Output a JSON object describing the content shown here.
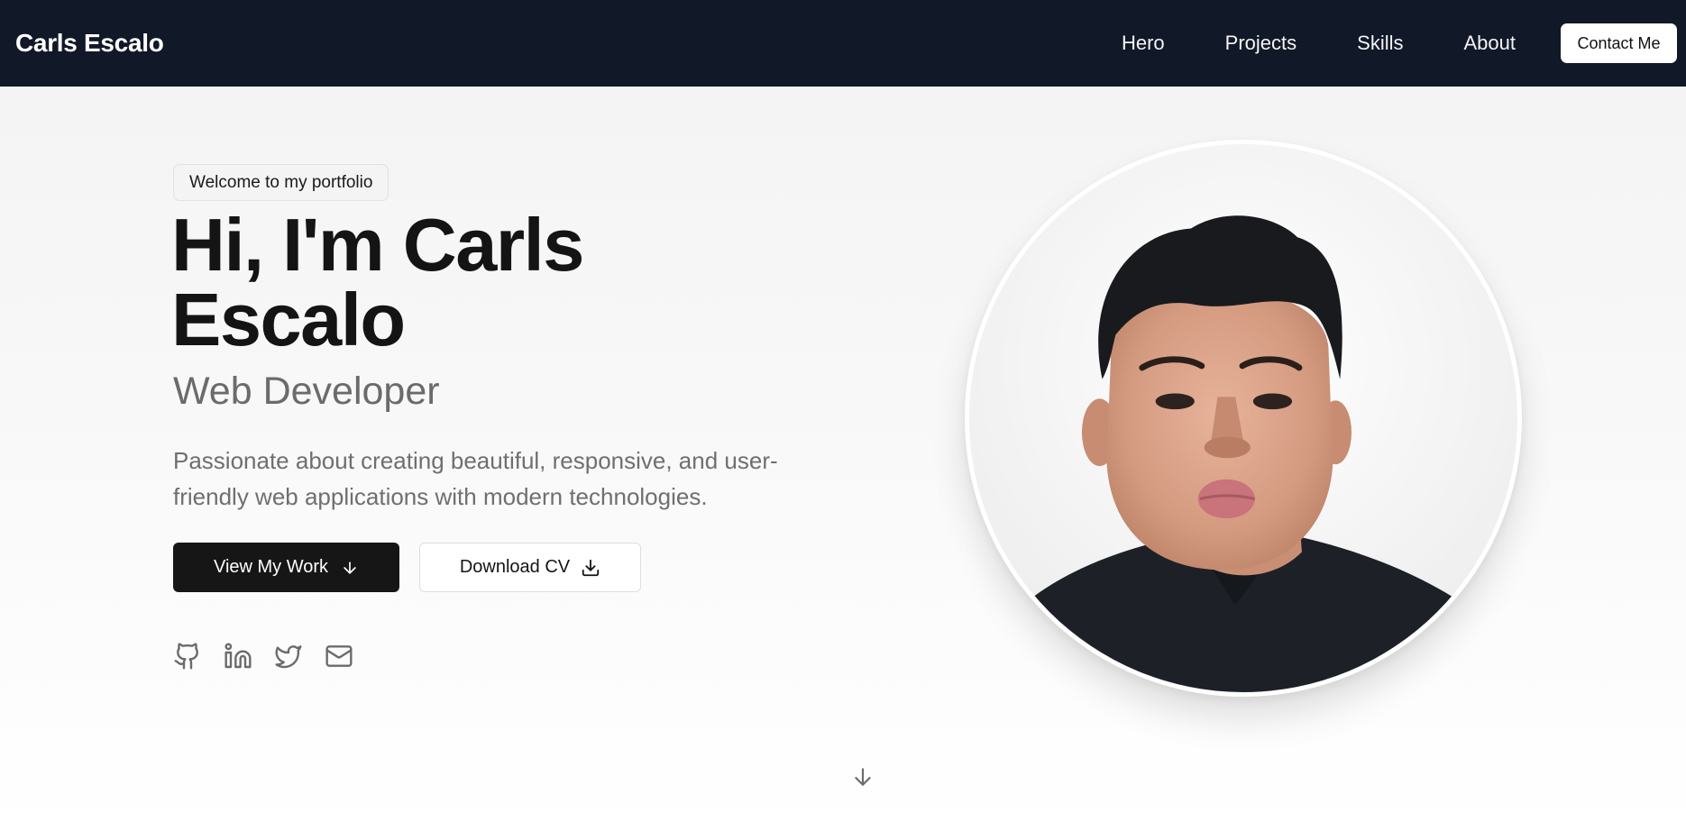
{
  "header": {
    "brand": "Carls Escalo",
    "nav": [
      "Hero",
      "Projects",
      "Skills",
      "About"
    ],
    "contact_label": "Contact Me"
  },
  "hero": {
    "badge": "Welcome to my portfolio",
    "title_line1": "Hi, I'm Carls",
    "title_line2": "Escalo",
    "subtitle": "Web Developer",
    "description": "Passionate about creating beautiful, responsive, and user-friendly web applications with modern technologies.",
    "primary_button": "View My Work",
    "secondary_button": "Download CV",
    "social_icons": [
      "github-icon",
      "linkedin-icon",
      "twitter-icon",
      "mail-icon"
    ]
  },
  "colors": {
    "nav_bg": "#111827",
    "primary_btn": "#161616",
    "muted_text": "#6b6b6b"
  }
}
